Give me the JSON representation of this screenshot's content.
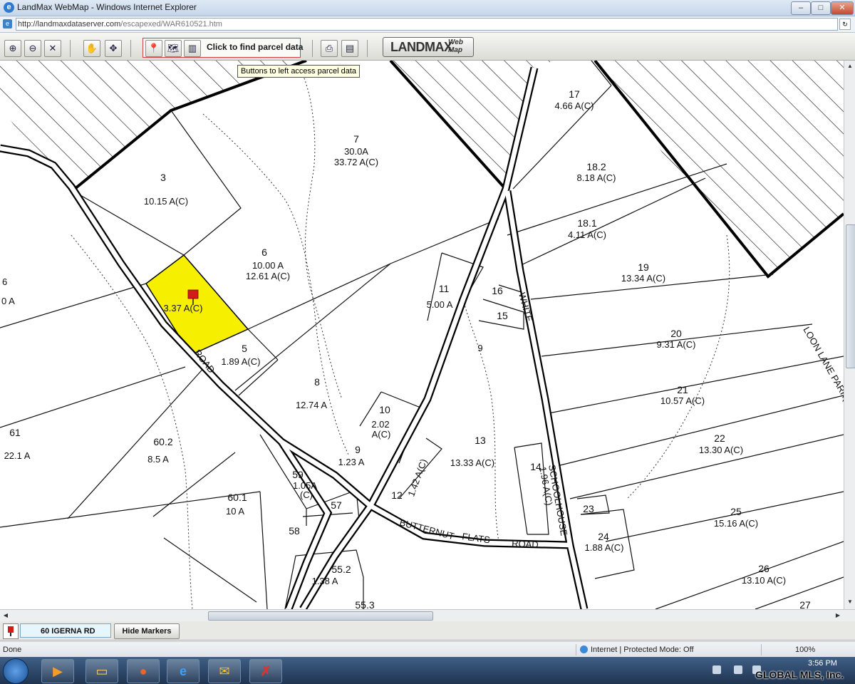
{
  "window": {
    "title": "LandMax WebMap - Windows Internet Explorer",
    "url_host": "http://landmaxdataserver.com",
    "url_path": "/escapexed/WAR610521.htm",
    "minimize": "–",
    "maximize": "□",
    "close": "✕"
  },
  "toolbar": {
    "parcel_label": "Click to find parcel data",
    "tooltip": "Buttons to left access parcel data",
    "logo_main": "LANDMAX",
    "logo_sub_1": "Web",
    "logo_sub_2": "Map",
    "icons": [
      "zoom-in-icon",
      "zoom-out-icon",
      "zoom-extent-icon",
      "pan-hand-icon",
      "recenter-icon",
      "parcel-id-icon",
      "parcel-map-icon",
      "parcel-table-icon",
      "print-icon",
      "notes-icon"
    ]
  },
  "map": {
    "parcels": [
      {
        "id": "3",
        "area": "10.15 A(C)"
      },
      {
        "id": "6",
        "area": "10.00 A",
        "area2": "12.61 A(C)"
      },
      {
        "id": "7",
        "area": "30.0A",
        "area2": "33.72 A(C)"
      },
      {
        "id": "17",
        "area": "4.66 A(C)"
      },
      {
        "id": "18.2",
        "area": "8.18 A(C)"
      },
      {
        "id": "18.1",
        "area": "4.11 A(C)"
      },
      {
        "id": "19",
        "area": "13.34 A(C)"
      },
      {
        "id": "20",
        "area": "9.31 A(C)"
      },
      {
        "id": "21",
        "area": "10.57 A(C)"
      },
      {
        "id": "22",
        "area": "13.30 A(C)"
      },
      {
        "id": "25",
        "area": "15.16 A(C)"
      },
      {
        "id": "26",
        "area": "13.10 A(C)"
      },
      {
        "id": "27"
      },
      {
        "id": "11",
        "area": "5.00 A"
      },
      {
        "id": "16"
      },
      {
        "id": "15"
      },
      {
        "id": "9"
      },
      {
        "id": "8",
        "area": "12.74 A"
      },
      {
        "id": "5",
        "area": "1.89 A(C)"
      },
      {
        "id": "10",
        "area": "2.02",
        "area2": "A(C)"
      },
      {
        "id": "9",
        "area": "1.23 A"
      },
      {
        "id": "13",
        "area": "13.33 A(C)"
      },
      {
        "id": "12",
        "area": "1.42 A(C)"
      },
      {
        "id": "14",
        "area": "1.96 A(C)"
      },
      {
        "id": "23"
      },
      {
        "id": "24",
        "area": "1.88 A(C)"
      },
      {
        "id": "61",
        "area": "22.1 A"
      },
      {
        "id": "60.2",
        "area": "8.5 A"
      },
      {
        "id": "60.1",
        "area": "10 A"
      },
      {
        "id": "59",
        "area": "1.05A",
        "area2": "(C)"
      },
      {
        "id": "57"
      },
      {
        "id": "58"
      },
      {
        "id": "55.2",
        "area": "1.38 A"
      },
      {
        "id": "55.3"
      }
    ],
    "highlight_area": "3.37 A(C)",
    "edge_left_1": "6",
    "edge_left_2": "0 A",
    "roads": {
      "road": "ROAD",
      "white": "WHITE",
      "schoolhouse": "SCHOOLHOUSE",
      "butternut": "BUTTERNUT",
      "flats": "FLATS",
      "road2": "ROAD",
      "loon_lane": "LOON LANE PARK(DISC)"
    },
    "highlight_color": "#f6f000"
  },
  "markerbar": {
    "address": "60 IGERNA RD",
    "hide_button": "Hide Markers"
  },
  "status": {
    "left": "Done",
    "zone": "Internet | Protected Mode: Off",
    "zoom": "100%"
  },
  "taskbar": {
    "clock": "3:56 PM",
    "watermark": "GLOBAL MLS, Inc."
  }
}
